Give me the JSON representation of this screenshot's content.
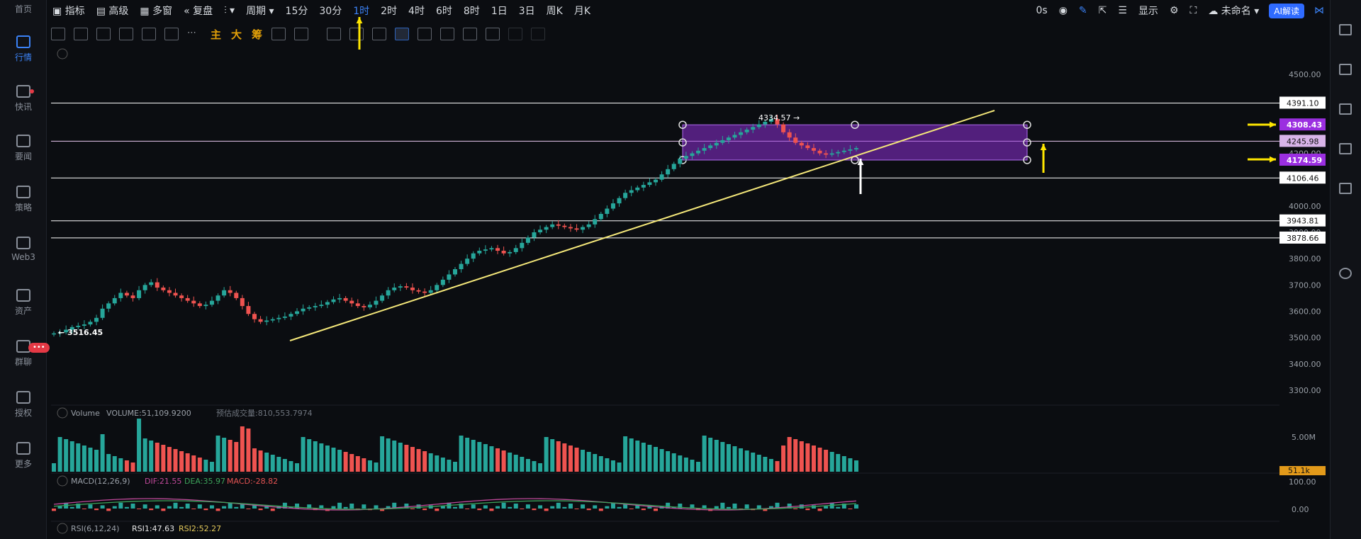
{
  "sidebar": [
    {
      "label": "首页",
      "active": false
    },
    {
      "label": "行情",
      "active": true
    },
    {
      "label": "快讯",
      "active": false
    },
    {
      "label": "要闻",
      "active": false
    },
    {
      "label": "策略",
      "active": false
    },
    {
      "label": "Web3",
      "active": false
    },
    {
      "label": "资产",
      "active": false
    },
    {
      "label": "群聊",
      "active": false
    },
    {
      "label": "授权",
      "active": false
    },
    {
      "label": "更多",
      "active": false
    }
  ],
  "sidebar_badge": "•••",
  "topbar": {
    "indicator": "指标",
    "advanced": "高级",
    "multi_window": "多窗",
    "replay": "复盘",
    "period": "周期",
    "intervals": [
      "15分",
      "30分",
      "1时",
      "2时",
      "4时",
      "6时",
      "8时",
      "1日",
      "3日",
      "周K",
      "月K"
    ],
    "active_interval": "1时",
    "countdown": "0s",
    "display": "显示",
    "unnamed": "未命名",
    "ai": "AI解读"
  },
  "toolbar": {
    "main": "主",
    "big": "大",
    "chips": "筹"
  },
  "price_axis": [
    "4500.00",
    "4400.00",
    "4300.00",
    "4200.00",
    "4100.00",
    "4000.00",
    "3900.00",
    "3800.00",
    "3700.00",
    "3600.00",
    "3500.00",
    "3400.00",
    "3300.00"
  ],
  "hlines": [
    {
      "price": 4391.1,
      "label": "4391.10",
      "style": "white"
    },
    {
      "price": 4245.98,
      "label": "4245.98",
      "style": "pink"
    },
    {
      "price": 4106.46,
      "label": "4106.46",
      "style": "white"
    },
    {
      "price": 3943.81,
      "label": "3943.81",
      "style": "white"
    },
    {
      "price": 3878.66,
      "label": "3878.66",
      "style": "white"
    }
  ],
  "box": {
    "top_price": 4308.43,
    "top_label": "4308.43",
    "bottom_price": 4174.59,
    "bottom_label": "4174.59",
    "color": "#8e2fd6"
  },
  "annotations": {
    "high": "4334.57 →",
    "low": "← 3516.45"
  },
  "volume": {
    "label": "Volume",
    "value": "VOLUME:51,109.9200",
    "estimate": "预估成交量:810,553.7974",
    "axis_label": "5.00M",
    "current": "51.1k"
  },
  "macd": {
    "label": "MACD(12,26,9)",
    "dif": "DIF:21.55",
    "dea": "DEA:35.97",
    "macd": "MACD:-28.82",
    "axis_top": "100.00",
    "axis_mid": "0.00"
  },
  "rsi": {
    "label": "RSI(6,12,24)",
    "rsi1": "RSI1:47.63",
    "rsi2": "RSI2:52.27"
  },
  "chart_data": {
    "type": "candlestick",
    "close_prices": [
      3516,
      3520,
      3530,
      3540,
      3545,
      3550,
      3560,
      3575,
      3610,
      3630,
      3650,
      3670,
      3660,
      3650,
      3680,
      3700,
      3710,
      3690,
      3680,
      3670,
      3660,
      3650,
      3640,
      3630,
      3620,
      3625,
      3640,
      3660,
      3680,
      3670,
      3650,
      3620,
      3590,
      3570,
      3560,
      3565,
      3570,
      3575,
      3580,
      3590,
      3600,
      3610,
      3615,
      3620,
      3625,
      3635,
      3645,
      3650,
      3640,
      3630,
      3620,
      3615,
      3625,
      3640,
      3660,
      3680,
      3690,
      3695,
      3690,
      3680,
      3675,
      3670,
      3680,
      3700,
      3720,
      3740,
      3760,
      3780,
      3800,
      3820,
      3830,
      3835,
      3840,
      3830,
      3820,
      3825,
      3840,
      3860,
      3880,
      3900,
      3910,
      3920,
      3930,
      3925,
      3920,
      3915,
      3910,
      3920,
      3930,
      3950,
      3970,
      3990,
      4010,
      4030,
      4050,
      4060,
      4070,
      4080,
      4090,
      4100,
      4120,
      4140,
      4160,
      4180,
      4190,
      4200,
      4210,
      4220,
      4230,
      4240,
      4250,
      4260,
      4270,
      4280,
      4290,
      4300,
      4310,
      4320,
      4330,
      4310,
      4280,
      4260,
      4240,
      4230,
      4220,
      4210,
      4200,
      4195,
      4200,
      4205,
      4210,
      4215,
      4220
    ]
  }
}
